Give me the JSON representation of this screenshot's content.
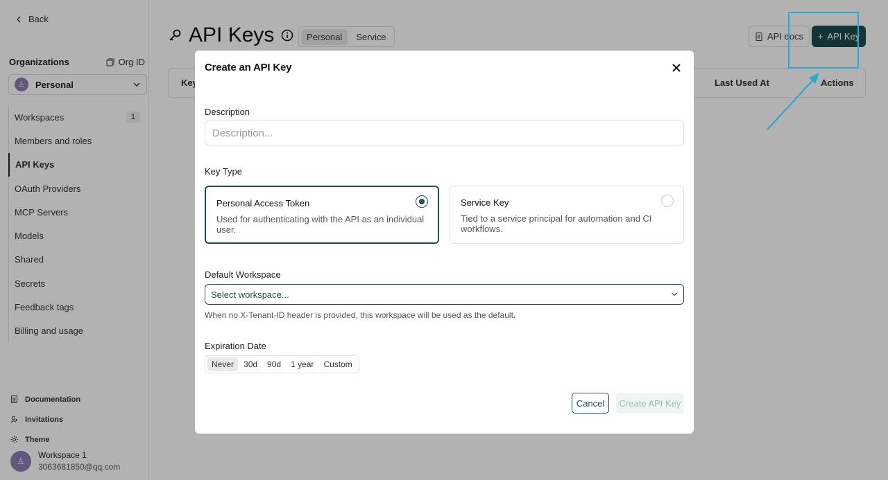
{
  "sidebar": {
    "back_label": "Back",
    "org_heading": "Organizations",
    "org_id_label": "Org ID",
    "org_selected": "Personal",
    "items": [
      {
        "label": "Workspaces",
        "count": "1"
      },
      {
        "label": "Members and roles"
      },
      {
        "label": "API Keys"
      },
      {
        "label": "OAuth Providers"
      },
      {
        "label": "MCP Servers"
      },
      {
        "label": "Models"
      },
      {
        "label": "Shared"
      },
      {
        "label": "Secrets"
      },
      {
        "label": "Feedback tags"
      },
      {
        "label": "Billing and usage"
      }
    ],
    "bottom": [
      "Documentation",
      "Invitations",
      "Theme"
    ],
    "user": {
      "name": "Workspace 1",
      "email": "3063681850@qq.com"
    }
  },
  "header": {
    "title": "API Keys",
    "tabs": [
      "Personal",
      "Service"
    ],
    "docs_label": "API docs",
    "add_label": "API Key"
  },
  "table": {
    "columns": [
      "Key",
      "Last Used At",
      "Actions"
    ]
  },
  "modal": {
    "title": "Create an API Key",
    "description_label": "Description",
    "description_placeholder": "Description...",
    "key_type_label": "Key Type",
    "options": [
      {
        "title": "Personal Access Token",
        "desc": "Used for authenticating with the API as an individual user."
      },
      {
        "title": "Service Key",
        "desc": "Tied to a service principal for automation and CI workflows."
      }
    ],
    "workspace_label": "Default Workspace",
    "workspace_placeholder": "Select workspace...",
    "workspace_hint": "When no X-Tenant-ID header is provided, this workspace will be used as the default.",
    "expiration_label": "Expiration Date",
    "expiration_options": [
      "Never",
      "30d",
      "90d",
      "1 year",
      "Custom"
    ],
    "cancel_label": "Cancel",
    "create_label": "Create API Key"
  },
  "colors": {
    "accent": "#1e4d4d",
    "annotation": "#29a9d1"
  }
}
